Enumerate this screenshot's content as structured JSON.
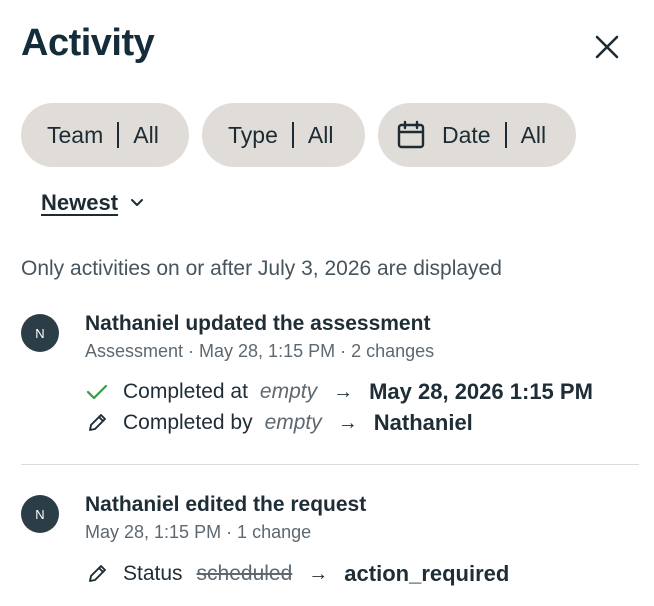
{
  "header": {
    "title": "Activity"
  },
  "filters": [
    {
      "label": "Team",
      "value": "All"
    },
    {
      "label": "Type",
      "value": "All"
    },
    {
      "label": "Date",
      "value": "All"
    }
  ],
  "sort": {
    "label": "Newest"
  },
  "notice": "Only activities on or after July 3, 2026 are displayed",
  "entries": [
    {
      "avatar": "N",
      "title": "Nathaniel updated the assessment",
      "meta": "Assessment · May 28, 1:15 PM · 2 changes",
      "changes": [
        {
          "icon": "check-icon",
          "field": "Completed at",
          "old": "empty",
          "arrow": "→",
          "new": "May 28, 2026 1:15 PM"
        },
        {
          "icon": "pencil-icon",
          "field": "Completed by",
          "old": "empty",
          "arrow": "→",
          "new": "Nathaniel"
        }
      ]
    },
    {
      "avatar": "N",
      "title": "Nathaniel edited the request",
      "meta": "May 28, 1:15 PM · 1 change",
      "changes": [
        {
          "icon": "pencil-icon",
          "field": "Status",
          "old": "scheduled",
          "arrow": "→",
          "new": "action_required"
        }
      ]
    }
  ],
  "colors": {
    "pill_bg": "#e0ddd8",
    "check": "#3a9a4a",
    "avatar_bg": "#2b3d47",
    "title": "#152c3a"
  }
}
